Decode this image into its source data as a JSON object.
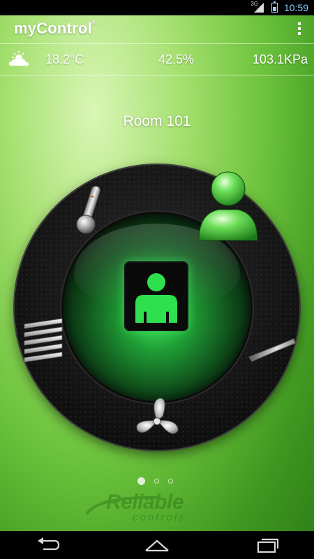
{
  "status_bar": {
    "network": "3G",
    "time": "10:59",
    "battery_level": 0.5
  },
  "action_bar": {
    "app_title": "myControl",
    "trademark": "®",
    "overflow_icon": "overflow-menu-icon"
  },
  "weather": {
    "icon": "partly-cloudy-icon",
    "temperature": "18.2°C",
    "humidity": "42.5%",
    "pressure": "103.1KPa"
  },
  "room": {
    "title": "Room 101"
  },
  "dial": {
    "center_icon": "occupancy-person-icon",
    "controls": [
      {
        "name": "temperature",
        "icon": "thermometer-icon"
      },
      {
        "name": "occupancy",
        "icon": "person-icon"
      },
      {
        "name": "blinds",
        "icon": "blinds-icon"
      },
      {
        "name": "vent",
        "icon": "vent-damper-icon"
      },
      {
        "name": "fan",
        "icon": "fan-icon"
      }
    ],
    "accent_color": "#2ed14a"
  },
  "pager": {
    "pages": 3,
    "active_index": 0
  },
  "logo": {
    "name": "Reliable",
    "tagline": "controls"
  },
  "nav_bar": {
    "back_icon": "back-icon",
    "home_icon": "home-icon",
    "recent_icon": "recent-apps-icon"
  }
}
